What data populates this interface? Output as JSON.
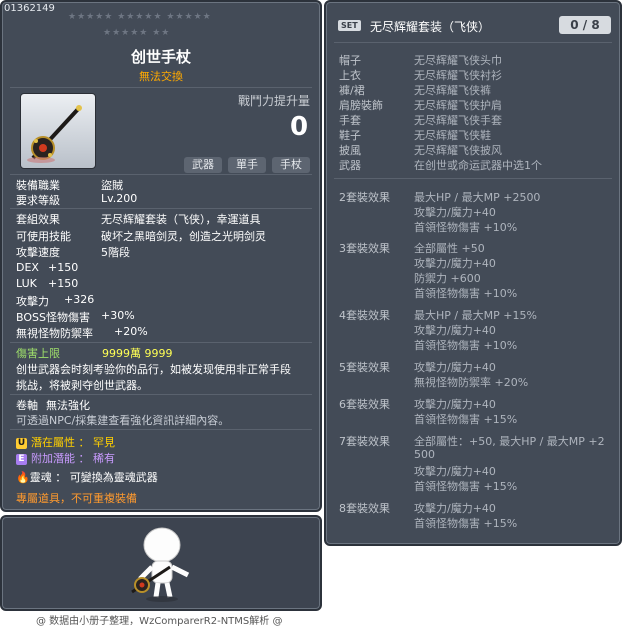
{
  "item": {
    "id": "01362149",
    "stars_row1": "★★★★★  ★★★★★  ★★★★★",
    "stars_row2": "★★★★★  ★★",
    "title": "创世手杖",
    "trade": "無法交換",
    "power_label": "戰鬥力提升量",
    "power_value": "0",
    "tags": [
      "武器",
      "單手",
      "手杖"
    ],
    "job_label": "裝備職業",
    "job_value": "盜賊",
    "req_label": "要求等級",
    "req_value": "Lv.200",
    "set_effect_label": "套組效果",
    "set_effect_value": "无尽辉耀套装（飞侠），幸運道具",
    "skill_label": "可使用技能",
    "skill_value": "破坏之黑暗剑灵，创造之光明剑灵",
    "speed_label": "攻擊速度",
    "speed_value": "5階段",
    "stats": [
      {
        "k": "DEX",
        "v": "+150"
      },
      {
        "k": "LUK",
        "v": "+150"
      },
      {
        "k": "攻擊力",
        "v": "+326"
      },
      {
        "k": "BOSS怪物傷害",
        "v": "+30%"
      },
      {
        "k": "無視怪物防禦率",
        "v": "+20%"
      }
    ],
    "damage_cap_label": "傷害上限",
    "damage_cap_value": "9999萬 9999",
    "desc_line1": "创世武器会时刻考验你的品行，如被发现使用非正常手段",
    "desc_line2": "挑战，将被剥夺创世武器。",
    "scroll_label": "卷軸",
    "scroll_value": "無法強化",
    "npc_note": "可透過NPC/採集建查看強化資訊詳細內容。",
    "potential_label": "潛在屬性",
    "potential_value": "罕見",
    "add_potential_label": "附加潛能",
    "add_potential_value": "稀有",
    "soul_label": "靈魂",
    "soul_value": "可變換為靈魂武器",
    "exclusive_note": "專屬道具，不可重複裝備"
  },
  "set": {
    "badge": "SET",
    "name": "无尽辉耀套装（飞侠）",
    "count": "0 / 8",
    "pieces": [
      {
        "k": "帽子",
        "v": "无尽辉耀飞侠头巾"
      },
      {
        "k": "上衣",
        "v": "无尽辉耀飞侠衬衫"
      },
      {
        "k": "褲/裙",
        "v": "无尽辉耀飞侠裤"
      },
      {
        "k": "肩膀裝飾",
        "v": "无尽辉耀飞侠护肩"
      },
      {
        "k": "手套",
        "v": "无尽辉耀飞侠手套"
      },
      {
        "k": "鞋子",
        "v": "无尽辉耀飞侠鞋"
      },
      {
        "k": "披風",
        "v": "无尽辉耀飞侠披风"
      },
      {
        "k": "武器",
        "v": "在创世或命运武器中选1个"
      }
    ],
    "effects": [
      {
        "k": "2套裝效果",
        "lines": [
          "最大HP / 最大MP  +2500",
          "攻擊力/魔力+40",
          "首領怪物傷害 +10%"
        ]
      },
      {
        "k": "3套裝效果",
        "lines": [
          "全部屬性 +50",
          "攻擊力/魔力+40",
          "防禦力  +600",
          "首領怪物傷害 +10%"
        ]
      },
      {
        "k": "4套裝效果",
        "lines": [
          "最大HP / 最大MP  +15%",
          "攻擊力/魔力+40",
          "首領怪物傷害 +10%"
        ]
      },
      {
        "k": "5套裝效果",
        "lines": [
          "攻擊力/魔力+40",
          "無視怪物防禦率 +20%"
        ]
      },
      {
        "k": "6套裝效果",
        "lines": [
          "攻擊力/魔力+40",
          "首領怪物傷害 +15%"
        ]
      },
      {
        "k": "7套裝效果",
        "lines": [
          "全部屬性：+50, 最大HP / 最大MP  +2",
          "500",
          "攻擊力/魔力+40",
          "首領怪物傷害 +15%"
        ]
      },
      {
        "k": "8套裝效果",
        "lines": [
          "攻擊力/魔力+40",
          "首領怪物傷害 +15%"
        ]
      }
    ]
  },
  "footer": "@ 数据由小册子整理，WzComparerR2-NTMS解析 @"
}
